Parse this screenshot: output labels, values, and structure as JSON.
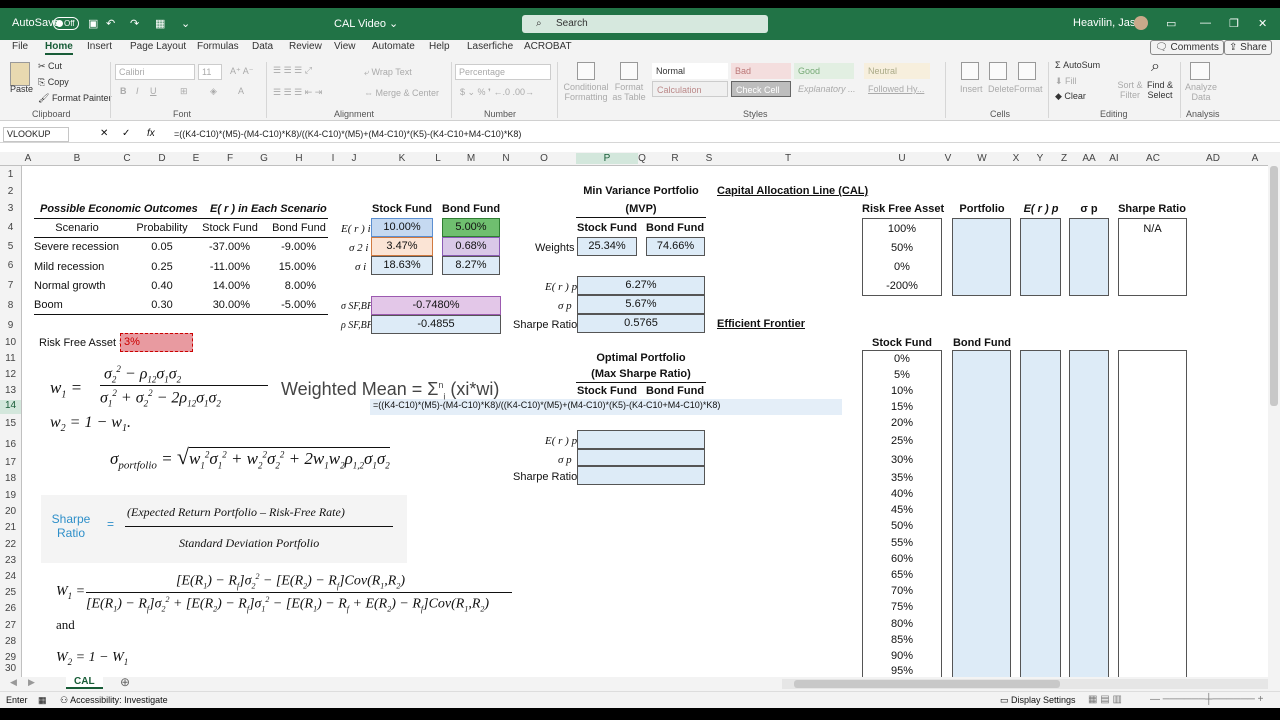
{
  "titlebar": {
    "autosave": "AutoSave",
    "autosave_state": "Off",
    "doc_title": "CAL Video ⌄",
    "search": "Search",
    "user": "Heavilin, Jason"
  },
  "menu": [
    "File",
    "Home",
    "Insert",
    "Page Layout",
    "Formulas",
    "Data",
    "Review",
    "View",
    "Automate",
    "Help",
    "Laserfiche",
    "ACROBAT"
  ],
  "comments": "Comments",
  "share": "Share",
  "ribbon": {
    "paste": "Paste",
    "cut": "Cut",
    "copy": "Copy",
    "format_painter": "Format Painter",
    "clipboard": "Clipboard",
    "font_name": "Calibri",
    "font_size": "11",
    "font": "Font",
    "wrap_text": "Wrap Text",
    "merge_center": "Merge & Center",
    "alignment": "Alignment",
    "number_format": "Percentage",
    "number": "Number",
    "cond_fmt": "Conditional Formatting",
    "fmt_table": "Format as Table",
    "styles": "Styles",
    "style_normal": "Normal",
    "style_bad": "Bad",
    "style_good": "Good",
    "style_neutral": "Neutral",
    "style_calc": "Calculation",
    "style_check": "Check Cell",
    "style_expl": "Explanatory ...",
    "style_follow": "Followed Hy...",
    "insert": "Insert",
    "delete": "Delete",
    "format": "Format",
    "cells": "Cells",
    "autosum": "AutoSum",
    "fill": "Fill",
    "clear": "Clear",
    "sort": "Sort & Filter",
    "find": "Find & Select",
    "editing": "Editing",
    "analyze": "Analyze Data",
    "analysis": "Analysis"
  },
  "namebox": "VLOOKUP",
  "formula": "=((K4-C10)*(M5)-(M4-C10)*K8)/((K4-C10)*(M5)+(M4-C10)*(K5)-(K4-C10+M4-C10)*K8)",
  "columns": [
    "A",
    "B",
    "C",
    "D",
    "E",
    "F",
    "G",
    "H",
    "I",
    "J",
    "K",
    "L",
    "M",
    "N",
    "O",
    "P",
    "Q",
    "R",
    "S",
    "T",
    "U",
    "V",
    "W",
    "X",
    "Y",
    "Z",
    "AA",
    "AI",
    "AC",
    "AD",
    "A"
  ],
  "rows": [
    "1",
    "2",
    "3",
    "4",
    "5",
    "6",
    "7",
    "8",
    "9",
    "10",
    "11",
    "12",
    "13",
    "14",
    "15",
    "16",
    "17",
    "18",
    "19",
    "20",
    "21",
    "22",
    "23",
    "24",
    "25",
    "26",
    "27",
    "28",
    "29",
    "30"
  ],
  "scenarios": {
    "title": "Possible Economic Outcomes",
    "title2": "E( r ) in Each Scenario",
    "headers": [
      "Scenario",
      "Probability",
      "Stock Fund",
      "Bond Fund"
    ],
    "rows": [
      [
        "Severe recession",
        "0.05",
        "-37.00%",
        "-9.00%"
      ],
      [
        "Mild recession",
        "0.25",
        "-11.00%",
        "15.00%"
      ],
      [
        "Normal growth",
        "0.40",
        "14.00%",
        "8.00%"
      ],
      [
        "Boom",
        "0.30",
        "30.00%",
        "-5.00%"
      ]
    ]
  },
  "stats": {
    "stock_hdr": "Stock Fund",
    "bond_hdr": "Bond Fund",
    "er_lbl": "E( r ) i",
    "var_lbl": "σ 2 i",
    "sd_lbl": "σ i",
    "er": [
      "10.00%",
      "5.00%"
    ],
    "var": [
      "3.47%",
      "0.68%"
    ],
    "sd": [
      "18.63%",
      "8.27%"
    ],
    "cov_lbl": "σ SF,BF",
    "cov": "-0.7480%",
    "rho_lbl": "ρ SF,BF",
    "rho": "-0.4855"
  },
  "rf": {
    "label": "Risk Free Asset =",
    "value": "3%"
  },
  "mvp": {
    "title": "Min Variance Portfolio",
    "title2": "(MVP)",
    "stock": "Stock Fund",
    "bond": "Bond Fund",
    "weights_lbl": "Weights",
    "w_stock": "25.34%",
    "w_bond": "74.66%",
    "er_lbl": "E( r ) p",
    "er": "6.27%",
    "sd_lbl": "σ p",
    "sd": "5.67%",
    "sharpe_lbl": "Sharpe Ratio",
    "sharpe": "0.5765"
  },
  "opt": {
    "title": "Optimal Portfolio",
    "title2": "(Max Sharpe Ratio)",
    "stock": "Stock Fund",
    "bond": "Bond Fund",
    "er_lbl": "E( r ) p",
    "sd_lbl": "σ p",
    "sharpe_lbl": "Sharpe Ratio"
  },
  "weighted_mean": "Weighted Mean = Σ",
  "weighted_mean2": "(xi*wi)",
  "cal": {
    "title": "Capital Allocation Line (CAL)",
    "headers": [
      "Risk Free Asset",
      "Portfolio",
      "E( r ) p",
      "σ p",
      "Sharpe Ratio"
    ],
    "rf_values": [
      "100%",
      "50%",
      "0%",
      "-200%"
    ],
    "na": "N/A"
  },
  "ef": {
    "title": "Efficient Frontier",
    "stock": "Stock Fund",
    "bond": "Bond Fund",
    "values": [
      "0%",
      "5%",
      "10%",
      "15%",
      "20%",
      "25%",
      "30%",
      "35%",
      "40%",
      "45%",
      "50%",
      "55%",
      "60%",
      "65%",
      "70%",
      "75%",
      "80%",
      "85%",
      "90%",
      "95%"
    ]
  },
  "sharpe_eq": {
    "name": "Sharpe Ratio",
    "eq": "=",
    "num": "(Expected Return Portfolio – Risk-Free Rate)",
    "den": "Standard Deviation Portfolio"
  },
  "and": "and",
  "sheet": {
    "tab": "CAL"
  },
  "status": {
    "mode": "Enter",
    "accessibility": "Accessibility: Investigate",
    "display": "Display Settings"
  }
}
